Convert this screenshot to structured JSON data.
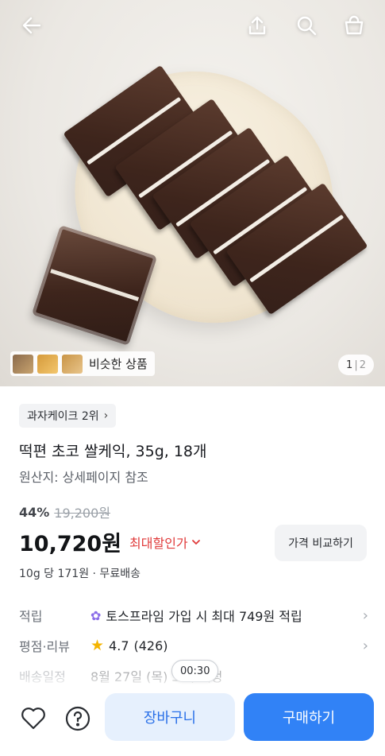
{
  "topbar": {
    "back_icon": "arrow-left-icon",
    "share_icon": "share-icon",
    "search_icon": "search-icon",
    "cart_icon": "shopping-bag-icon"
  },
  "hero": {
    "similar_label": "비슷한 상품",
    "pager_current": "1",
    "pager_sep": "|",
    "pager_total": "2"
  },
  "product": {
    "rank_label": "과자케이크 2위",
    "title": "떡편 초코 쌀케익, 35g, 18개",
    "origin": "원산지: 상세페이지 참조",
    "discount": "44%",
    "original_price": "19,200원",
    "price": "10,720원",
    "max_discount_label": "최대할인가",
    "compare_label": "가격 비교하기",
    "unit_line": "10g 당 171원 · 무료배송"
  },
  "info": {
    "points_label": "적립",
    "points_value": "토스프라임 가입 시 최대 749원 적립",
    "review_label": "평점·리뷰",
    "rating": "4.7",
    "review_count": "(426)",
    "delivery_label": "배송일정",
    "delivery_value": "8월 27일 (목) 도착 예정"
  },
  "overlay": {
    "timer": "00:30"
  },
  "bottom": {
    "cart_label": "장바구니",
    "buy_label": "구매하기"
  },
  "colors": {
    "accent_blue": "#3182f6",
    "accent_light_blue": "#e6f0fd",
    "discount_red": "#e03a3a",
    "star": "#f4b400"
  }
}
